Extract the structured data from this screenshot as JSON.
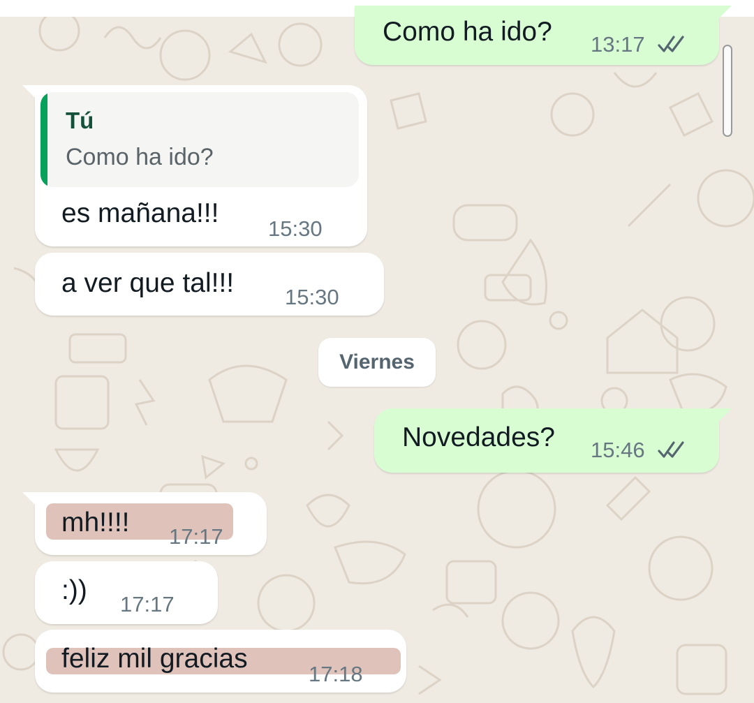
{
  "colors": {
    "background": "#efeae2",
    "incoming_bubble": "#ffffff",
    "outgoing_bubble": "#d9fdd3",
    "quote_bar": "#06a15b",
    "highlight": "#dfc3bb",
    "read_ticks": "#54656f"
  },
  "messages": [
    {
      "direction": "out",
      "text": "Como ha ido?",
      "time": "13:17",
      "status": "read-ticks-icon"
    },
    {
      "direction": "in",
      "reply_to": {
        "author": "Tú",
        "text": "Como ha ido?"
      },
      "text": "es mañana!!!",
      "time": "15:30"
    },
    {
      "direction": "in",
      "text": "a ver que tal!!!",
      "time": "15:30"
    },
    {
      "direction": "out",
      "text": "Novedades?",
      "time": "15:46",
      "status": "read-ticks-icon"
    },
    {
      "direction": "in",
      "text": "mh!!!!",
      "time": "17:17",
      "highlighted": true
    },
    {
      "direction": "in",
      "text": ":))",
      "time": "17:17"
    },
    {
      "direction": "in",
      "text": "feliz mil gracias",
      "time": "17:18",
      "highlighted": true
    }
  ],
  "date_separator": "Viernes"
}
